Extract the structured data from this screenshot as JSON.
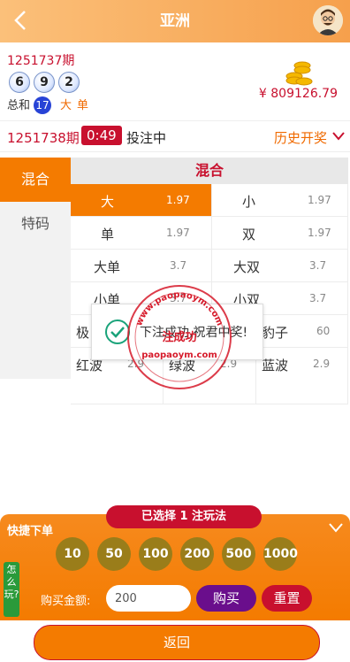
{
  "header": {
    "title": "亚洲",
    "back_icon": "chevron-left-icon",
    "avatar_icon": "avatar-icon"
  },
  "last_draw": {
    "issue": "1251737期",
    "balls": [
      "6",
      "9",
      "2"
    ],
    "sum_label": "总和",
    "sum_value": "17",
    "size_tag": "大",
    "parity_tag": "单",
    "balance": "¥ 809126.79"
  },
  "current_draw": {
    "issue": "1251738期",
    "countdown": "0:49",
    "status": "投注中",
    "history_label": "历史开奖"
  },
  "sidebar": {
    "items": [
      {
        "label": "混合",
        "active": true
      },
      {
        "label": "特码",
        "active": false
      }
    ]
  },
  "panel": {
    "title": "混合",
    "rows": [
      [
        {
          "name": "大",
          "odds": "1.97",
          "active": true
        },
        {
          "name": "小",
          "odds": "1.97",
          "active": false
        }
      ],
      [
        {
          "name": "单",
          "odds": "1.97",
          "active": false
        },
        {
          "name": "双",
          "odds": "1.97",
          "active": false
        }
      ],
      [
        {
          "name": "大单",
          "odds": "3.7",
          "active": false
        },
        {
          "name": "大双",
          "odds": "3.7",
          "active": false
        }
      ],
      [
        {
          "name": "小单",
          "odds": "3.7",
          "active": false
        },
        {
          "name": "小双",
          "odds": "3.7",
          "active": false
        }
      ]
    ],
    "row3": [
      {
        "name": "极",
        "odds": "",
        "active": false
      },
      {
        "name": "",
        "odds": "",
        "active": false
      },
      {
        "name": "豹子",
        "odds": "60",
        "active": false
      }
    ],
    "row4": [
      {
        "name": "红波",
        "odds": "2.9",
        "active": false
      },
      {
        "name": "绿波",
        "odds": "2.9",
        "active": false
      },
      {
        "name": "蓝波",
        "odds": "2.9",
        "active": false
      }
    ]
  },
  "dialog": {
    "message": "下注成功,祝君中奖!"
  },
  "watermark": {
    "text_top": "www.paopaoym.com",
    "text_mid": "注成功",
    "text_bottom": "paopaoym.com"
  },
  "bottom": {
    "selected": "已选择 1 注玩法",
    "quick_label": "快捷下单",
    "chips": [
      "10",
      "50",
      "100",
      "200",
      "500",
      "1000"
    ],
    "howto": "怎么玩?",
    "amount_label": "购买金额:",
    "amount_value": "200",
    "buy_label": "购买",
    "reset_label": "重置"
  },
  "footer": {
    "back_label": "返回"
  },
  "colors": {
    "accent": "#f47b00",
    "red": "#c8102e",
    "header_gradient_start": "#fbc07a",
    "purple": "#6a0e8c",
    "chip": "#9a7d1a"
  }
}
